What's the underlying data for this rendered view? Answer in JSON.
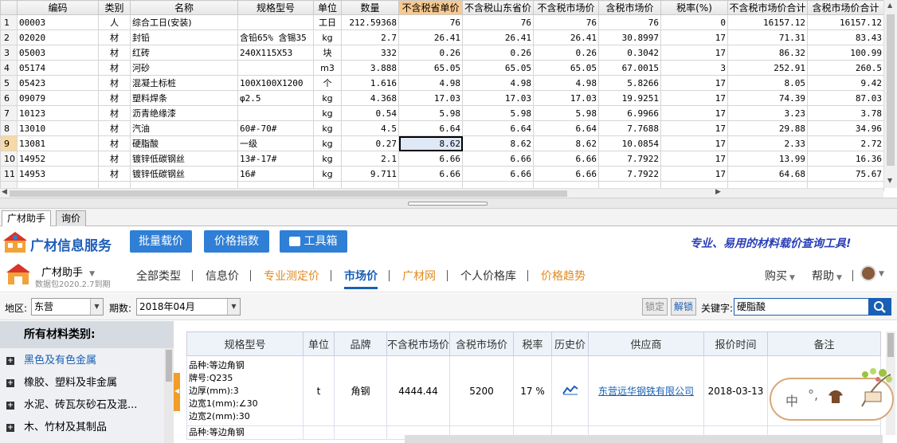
{
  "grid": {
    "columns": [
      "",
      "编码",
      "类别",
      "名称",
      "规格型号",
      "单位",
      "数量",
      "不含税省单价",
      "不含税山东省价",
      "不含税市场价",
      "含税市场价",
      "税率(%)",
      "不含税市场价合计",
      "含税市场价合计"
    ],
    "highlight_column": "不含税省单价",
    "rows": [
      {
        "no": "1",
        "code": "00003",
        "type": "人",
        "name": "综合工日(安装)",
        "spec": "",
        "unit": "工日",
        "qty": "212.59368",
        "p1": "76",
        "p2": "76",
        "p3": "76",
        "p4": "76",
        "tax": "0",
        "t1": "16157.12",
        "t2": "16157.12"
      },
      {
        "no": "2",
        "code": "02020",
        "type": "材",
        "name": "封铅",
        "spec": "含铅65% 含锡35",
        "unit": "kg",
        "qty": "2.7",
        "p1": "26.41",
        "p2": "26.41",
        "p3": "26.41",
        "p4": "30.8997",
        "tax": "17",
        "t1": "71.31",
        "t2": "83.43"
      },
      {
        "no": "3",
        "code": "05003",
        "type": "材",
        "name": "红砖",
        "spec": "240X115X53",
        "unit": "块",
        "qty": "332",
        "p1": "0.26",
        "p2": "0.26",
        "p3": "0.26",
        "p4": "0.3042",
        "tax": "17",
        "t1": "86.32",
        "t2": "100.99"
      },
      {
        "no": "4",
        "code": "05174",
        "type": "材",
        "name": "河砂",
        "spec": "",
        "unit": "m3",
        "qty": "3.888",
        "p1": "65.05",
        "p2": "65.05",
        "p3": "65.05",
        "p4": "67.0015",
        "tax": "3",
        "t1": "252.91",
        "t2": "260.5"
      },
      {
        "no": "5",
        "code": "05423",
        "type": "材",
        "name": "混凝土标桩",
        "spec": "100X100X1200",
        "unit": "个",
        "qty": "1.616",
        "p1": "4.98",
        "p2": "4.98",
        "p3": "4.98",
        "p4": "5.8266",
        "tax": "17",
        "t1": "8.05",
        "t2": "9.42"
      },
      {
        "no": "6",
        "code": "09079",
        "type": "材",
        "name": "塑料焊条",
        "spec": "φ2.5",
        "unit": "kg",
        "qty": "4.368",
        "p1": "17.03",
        "p2": "17.03",
        "p3": "17.03",
        "p4": "19.9251",
        "tax": "17",
        "t1": "74.39",
        "t2": "87.03"
      },
      {
        "no": "7",
        "code": "10123",
        "type": "材",
        "name": "沥青绝缘漆",
        "spec": "",
        "unit": "kg",
        "qty": "0.54",
        "p1": "5.98",
        "p2": "5.98",
        "p3": "5.98",
        "p4": "6.9966",
        "tax": "17",
        "t1": "3.23",
        "t2": "3.78"
      },
      {
        "no": "8",
        "code": "13010",
        "type": "材",
        "name": "汽油",
        "spec": "60#-70#",
        "unit": "kg",
        "qty": "4.5",
        "p1": "6.64",
        "p2": "6.64",
        "p3": "6.64",
        "p4": "7.7688",
        "tax": "17",
        "t1": "29.88",
        "t2": "34.96"
      },
      {
        "no": "9",
        "code": "13081",
        "type": "材",
        "name": "硬脂酸",
        "spec": "一级",
        "unit": "kg",
        "qty": "0.27",
        "p1": "8.62",
        "p2": "8.62",
        "p3": "8.62",
        "p4": "10.0854",
        "tax": "17",
        "t1": "2.33",
        "t2": "2.72"
      },
      {
        "no": "10",
        "code": "14952",
        "type": "材",
        "name": "镀锌低碳钢丝",
        "spec": "13#-17#",
        "unit": "kg",
        "qty": "2.1",
        "p1": "6.66",
        "p2": "6.66",
        "p3": "6.66",
        "p4": "7.7922",
        "tax": "17",
        "t1": "13.99",
        "t2": "16.36"
      },
      {
        "no": "11",
        "code": "14953",
        "type": "材",
        "name": "镀锌低碳钢丝",
        "spec": "16#",
        "unit": "kg",
        "qty": "9.711",
        "p1": "6.66",
        "p2": "6.66",
        "p3": "6.66",
        "p4": "7.7922",
        "tax": "17",
        "t1": "64.68",
        "t2": "75.67"
      }
    ]
  },
  "panel_tabs": [
    "广材助手",
    "询价"
  ],
  "banner": {
    "brand": "广材信息服务",
    "buttons": [
      "批量载价",
      "价格指数",
      "工具箱"
    ],
    "slogan": "专业、易用的材料载价查询工具!"
  },
  "nav": {
    "account": "广材助手",
    "account_sub": "数据包2020.2.7到期",
    "items": [
      "全部类型",
      "信息价",
      "专业测定价",
      "市场价",
      "广材网",
      "个人价格库",
      "价格趋势"
    ],
    "right": [
      "购买",
      "帮助"
    ]
  },
  "filter": {
    "region_label": "地区:",
    "region": "东营",
    "period_label": "期数:",
    "period": "2018年04月",
    "lock": "锁定",
    "unlock": "解锁",
    "keyword_label": "关键字:",
    "keyword": "硬脂酸"
  },
  "categories": {
    "title": "所有材料类别:",
    "items": [
      "黑色及有色金属",
      "橡胶、塑料及非金属",
      "水泥、砖瓦灰砂石及混...",
      "木、竹材及其制品"
    ]
  },
  "results": {
    "columns": [
      "规格型号",
      "单位",
      "品牌",
      "不含税市场价",
      "含税市场价",
      "税率",
      "历史价",
      "供应商",
      "报价时间",
      "备注"
    ],
    "row": {
      "spec_lines": [
        "品种:等边角钢",
        "牌号:Q235",
        "边厚(mm):3",
        "边宽1(mm):∠30",
        "边宽2(mm):30"
      ],
      "unit": "t",
      "brand": "角钢",
      "price_ex": "4444.44",
      "price_in": "5200",
      "tax": "17 %",
      "supplier": "东营远华钢铁有限公司",
      "date": "2018-03-13"
    },
    "next_spec": "品种:等边角钢"
  },
  "chat": {
    "a": "中",
    "b": "°,"
  },
  "colors": {
    "accent": "#1a5fb4",
    "orange": "#e08a1e",
    "highlight_header": "#f7c98f"
  }
}
